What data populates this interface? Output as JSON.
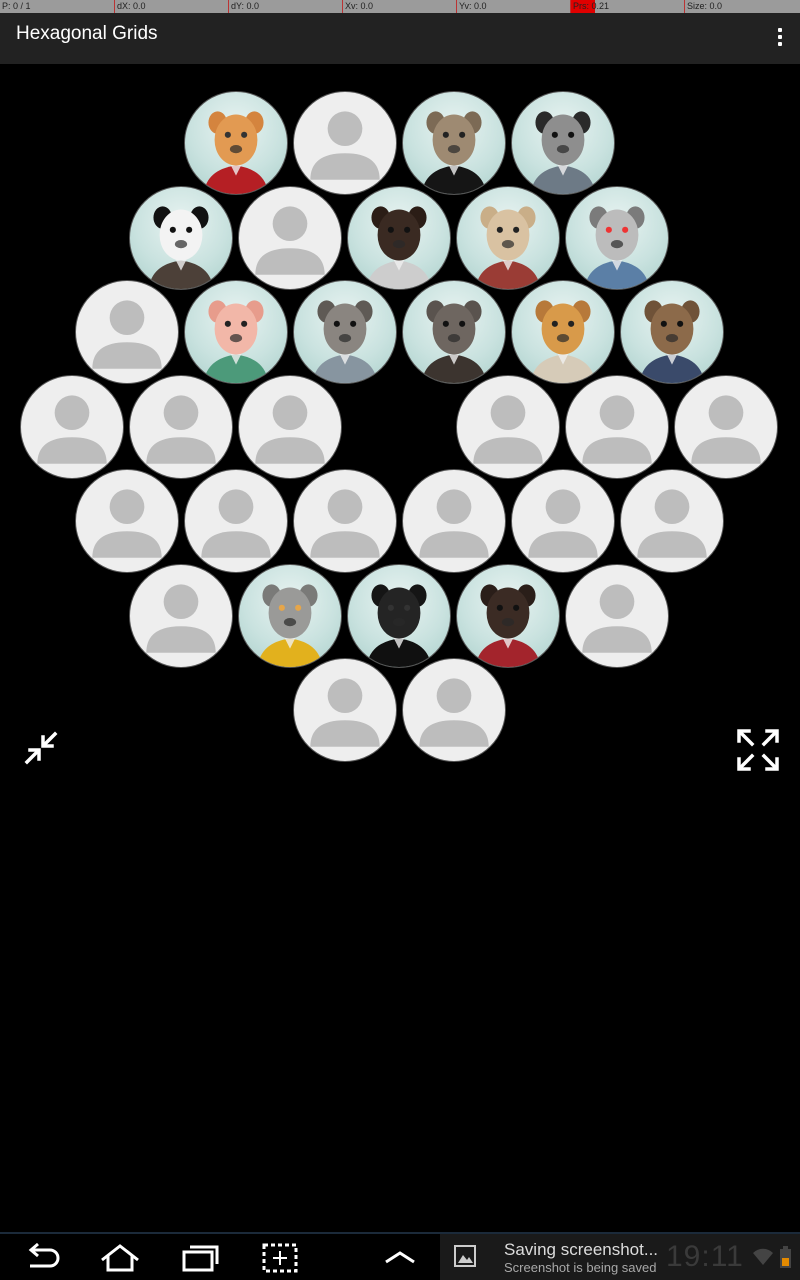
{
  "debug_bar": {
    "cells": [
      "P: 0 / 1",
      "dX: 0.0",
      "dY: 0.0",
      "Xv: 0.0",
      "Yv: 0.0",
      "Prs: 0.21",
      "Size: 0.0"
    ],
    "pressure": 0.21
  },
  "action_bar": {
    "title": "Hexagonal Grids",
    "overflow_icon": "overflow-menu-icon"
  },
  "grid": {
    "rows": [
      [
        "cat",
        "empty",
        "wolf",
        "ostrich"
      ],
      [
        "panda",
        "empty",
        "bear",
        "llama",
        "lemur"
      ],
      [
        "empty",
        "pig",
        "raccoon",
        "rhino",
        "giraffe",
        "sloth"
      ],
      [
        "empty",
        "empty",
        "empty",
        null,
        "empty",
        "empty",
        "empty"
      ],
      [
        "empty",
        "empty",
        "empty",
        "empty",
        "empty",
        "empty"
      ],
      [
        "empty",
        "owl",
        "bull",
        "monkey",
        "empty"
      ],
      [
        "empty",
        "empty"
      ]
    ]
  },
  "controls": {
    "zoom_in_icon": "zoom-in-icon",
    "zoom_out_icon": "zoom-out-icon"
  },
  "system_bar": {
    "buttons": [
      "back-icon",
      "home-icon",
      "recent-apps-icon",
      "screenshot-icon",
      "chevron-up-icon"
    ],
    "notification_title": "Saving screenshot...",
    "notification_subtitle": "Screenshot is being saved",
    "clock": "19:11"
  }
}
